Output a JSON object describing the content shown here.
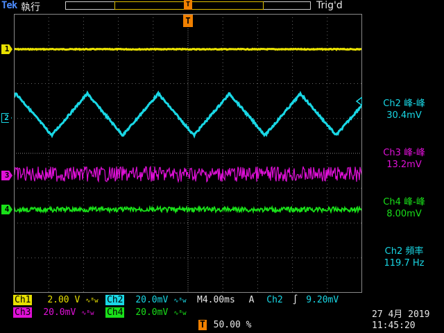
{
  "header": {
    "brand": "Tek",
    "run_state": "執行",
    "trigger_status": "Trig'd",
    "trigger_marker": "T"
  },
  "colors": {
    "ch1": "#e8e000",
    "ch2": "#19d8e6",
    "ch3": "#e010d8",
    "ch4": "#19e019",
    "trigger": "#f08000"
  },
  "channels": [
    {
      "id": "1",
      "marker": "1"
    },
    {
      "id": "2",
      "marker": "2"
    },
    {
      "id": "3",
      "marker": "3"
    },
    {
      "id": "4",
      "marker": "4"
    }
  ],
  "measurements": [
    {
      "label": "Ch2 峰-峰",
      "value": "30.4mV",
      "channel": "ch2"
    },
    {
      "label": "Ch3 峰-峰",
      "value": "13.2mV",
      "channel": "ch3"
    },
    {
      "label": "Ch4 峰-峰",
      "value": "8.00mV",
      "channel": "ch4"
    },
    {
      "label": "Ch2 頻率",
      "value": "119.7 Hz",
      "channel": "ch2"
    }
  ],
  "readout": {
    "ch1_label": "Ch1",
    "ch1_scale": "2.00 V",
    "ch2_label": "Ch2",
    "ch2_scale": "20.0mV",
    "ch3_label": "Ch3",
    "ch3_scale": "20.0mV",
    "ch4_label": "Ch4",
    "ch4_scale": "20.0mV",
    "coupling_symbol": "∿ᴮw",
    "timebase": "M4.00ms",
    "trigger_mode": "A",
    "trigger_source": "Ch2",
    "trigger_slope": "∫",
    "trigger_level": "9.20mV",
    "trigger_position": "50.00 %",
    "date": "27 4月  2019",
    "time": "11:45:20"
  }
}
